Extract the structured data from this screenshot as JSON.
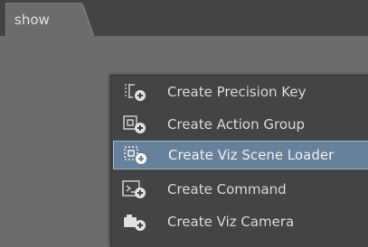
{
  "tab": {
    "label": "show"
  },
  "context_menu": {
    "items": [
      {
        "label": "Create Precision Key",
        "icon": "precision-key-add-icon",
        "selected": false
      },
      {
        "label": "Create Action Group",
        "icon": "action-group-add-icon",
        "selected": false
      },
      {
        "label": "Create Viz Scene Loader",
        "icon": "scene-loader-add-icon",
        "selected": true
      },
      {
        "label": "Create Command",
        "icon": "command-add-icon",
        "selected": false
      },
      {
        "label": "Create Viz Camera",
        "icon": "camera-add-icon",
        "selected": false
      }
    ]
  },
  "colors": {
    "background": "#6b6c6e",
    "topbar": "#434446",
    "menu": "#434446",
    "selected": "#67819a",
    "text": "#d9d9d9"
  }
}
